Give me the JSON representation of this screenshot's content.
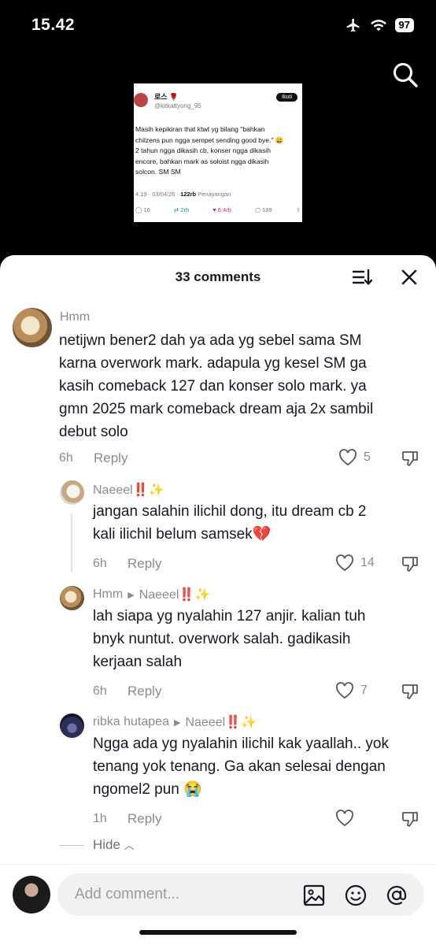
{
  "status": {
    "time": "15.42",
    "battery": "97"
  },
  "video": {
    "name": "로스 🌹",
    "handle": "@kitkattyong_95",
    "follow": "Ikuti",
    "text": "Masih kepikiran that ktwt yg bilang \"bahkan\nchilzens pun ngga sempet sending good bye.\" 😀\n2 tahun ngga dikasih cb, konser ngga dikasih\nencore, bahkan mark as soloist ngga dikasih\nsolcon. SM SM",
    "meta_time": "4.19 · 03/04/26 · ",
    "meta_views": "122rb",
    "meta_views_label": " Penayangan",
    "replies": "16",
    "retweets": "2rb",
    "likes": "6,4rb",
    "bookmarks": "188"
  },
  "sheet": {
    "count": "33 comments"
  },
  "comments": [
    {
      "user": "Hmm",
      "text": "netijwn bener2 dah ya ada yg sebel sama SM\nkarna overwork mark. adapula yg kesel SM ga\nkasih comeback 127 dan konser solo mark. ya\ngmn 2025 mark comeback dream aja 2x sambil\ndebut solo",
      "time": "6h",
      "reply": "Reply",
      "likes": "5"
    },
    {
      "user": "Naeeel‼️✨",
      "text": "jangan salahin ilichil dong, itu dream cb 2\nkali ilichil belum samsek💔",
      "time": "6h",
      "reply": "Reply",
      "likes": "14"
    },
    {
      "user": "Hmm",
      "to": "Naeeel‼️✨",
      "text": "lah siapa yg nyalahin 127 anjir. kalian tuh\nbnyk nuntut. overwork salah. gadikasih\nkerjaan salah",
      "time": "6h",
      "reply": "Reply",
      "likes": "7"
    },
    {
      "user": "ribka hutapea",
      "to": "Naeeel‼️✨",
      "text": "Ngga ada yg nyalahin ilichil kak yaallah.. yok\ntenang yok tenang. Ga akan selesai dengan\nngomel2 pun 😭",
      "time": "1h",
      "reply": "Reply",
      "likes": ""
    }
  ],
  "hide": "Hide",
  "input": {
    "placeholder": "Add comment..."
  }
}
